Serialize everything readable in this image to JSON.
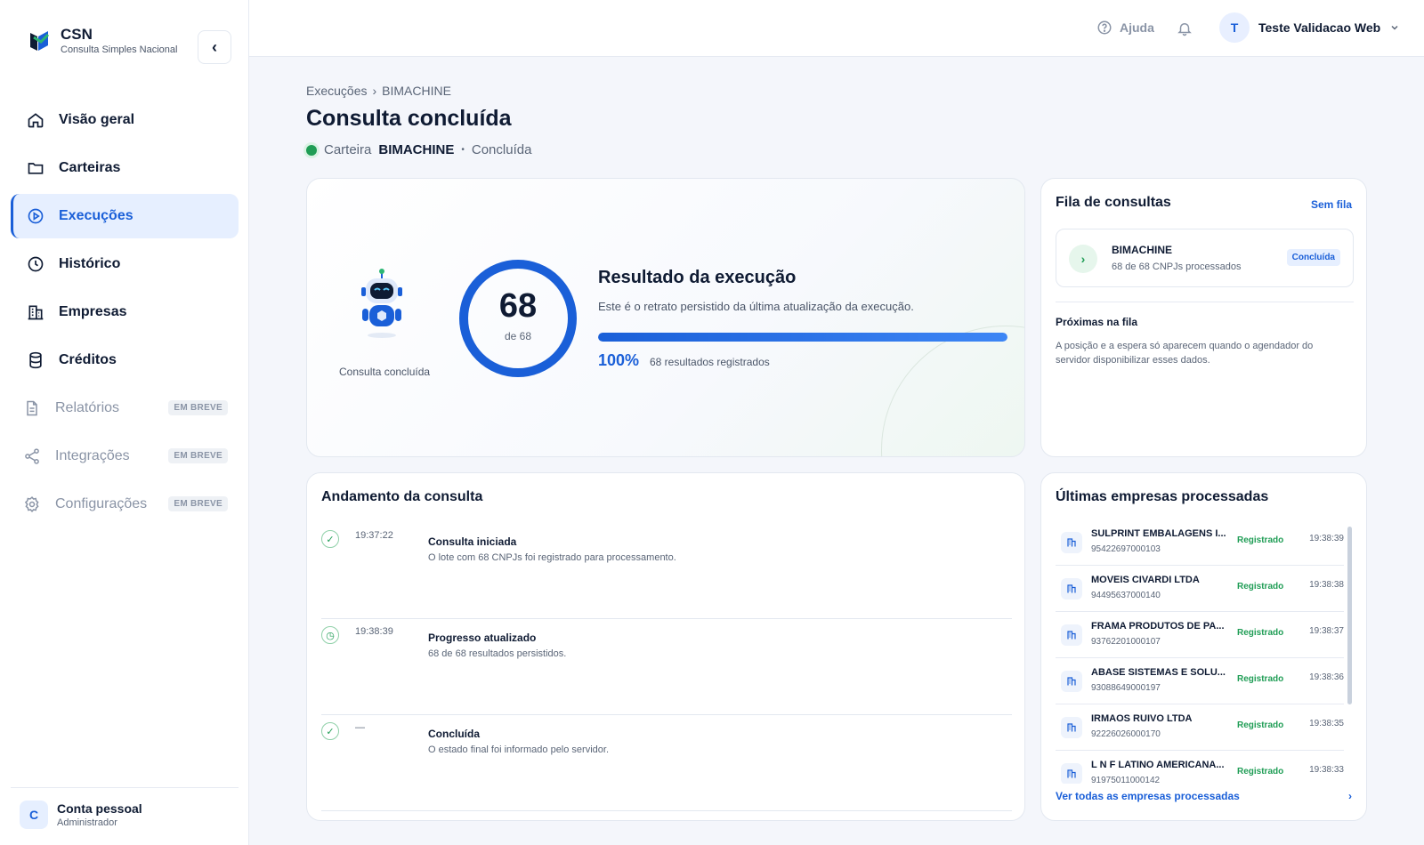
{
  "brand": {
    "title": "CSN",
    "subtitle": "Consulta Simples Nacional"
  },
  "sidebar": {
    "items": [
      {
        "label": "Visão geral",
        "icon": "home-icon"
      },
      {
        "label": "Carteiras",
        "icon": "folder-icon"
      },
      {
        "label": "Execuções",
        "icon": "play-circle-icon",
        "active": true
      },
      {
        "label": "Histórico",
        "icon": "clock-icon"
      },
      {
        "label": "Empresas",
        "icon": "building-icon"
      },
      {
        "label": "Créditos",
        "icon": "database-icon"
      },
      {
        "label": "Relatórios",
        "icon": "document-icon",
        "badge": "EM BREVE"
      },
      {
        "label": "Integrações",
        "icon": "share-icon",
        "badge": "EM BREVE"
      },
      {
        "label": "Configurações",
        "icon": "gear-icon",
        "badge": "EM BREVE"
      }
    ],
    "account": {
      "initial": "C",
      "name": "Conta pessoal",
      "role": "Administrador"
    }
  },
  "topbar": {
    "help_label": "Ajuda",
    "user_initial": "T",
    "user_name": "Teste Validacao Web"
  },
  "breadcrumb": {
    "parent": "Execuções",
    "separator": "›",
    "current": "BIMACHINE"
  },
  "page": {
    "title": "Consulta concluída",
    "wallet_label": "Carteira",
    "wallet_name": "BIMACHINE",
    "separator": "•",
    "status": "Concluída"
  },
  "result": {
    "robot_label": "Consulta concluída",
    "count": "68",
    "of_total": "de 68",
    "title": "Resultado da execução",
    "description": "Este é o retrato persistido da última atualização da execução.",
    "progress": 1.0,
    "percent_label": "100%",
    "records_label": "68 resultados registrados"
  },
  "queue": {
    "title": "Fila de consultas",
    "link": "Sem fila",
    "item": {
      "name": "BIMACHINE",
      "sub": "68 de 68 CNPJs processados",
      "badge": "Concluída"
    },
    "next_title": "Próximas na fila",
    "next_desc": "A posição e a espera só aparecem quando o agendador do servidor disponibilizar esses dados."
  },
  "progress": {
    "title": "Andamento da consulta",
    "events": [
      {
        "time": "19:37:22",
        "title": "Consulta iniciada",
        "desc": "O lote com 68 CNPJs foi registrado para processamento.",
        "icon": "check-icon"
      },
      {
        "time": "19:38:39",
        "title": "Progresso atualizado",
        "desc": "68 de 68 resultados persistidos.",
        "icon": "clock-icon"
      },
      {
        "time": "—",
        "title": "Concluída",
        "desc": "O estado final foi informado pelo servidor.",
        "icon": "check-icon"
      }
    ]
  },
  "latest": {
    "title": "Últimas empresas processadas",
    "companies": [
      {
        "name": "SULPRINT EMBALAGENS I...",
        "cnpj": "95422697000103",
        "status": "Registrado",
        "time": "19:38:39"
      },
      {
        "name": "MOVEIS CIVARDI LTDA",
        "cnpj": "94495637000140",
        "status": "Registrado",
        "time": "19:38:38"
      },
      {
        "name": "FRAMA PRODUTOS DE PA...",
        "cnpj": "93762201000107",
        "status": "Registrado",
        "time": "19:38:37"
      },
      {
        "name": "ABASE SISTEMAS E SOLU...",
        "cnpj": "93088649000197",
        "status": "Registrado",
        "time": "19:38:36"
      },
      {
        "name": "IRMAOS RUIVO LTDA",
        "cnpj": "92226026000170",
        "status": "Registrado",
        "time": "19:38:35"
      },
      {
        "name": "L N F LATINO AMERICANA...",
        "cnpj": "91975011000142",
        "status": "Registrado",
        "time": "19:38:33"
      }
    ],
    "see_all": "Ver todas as empresas processadas",
    "see_all_arrow": "›"
  },
  "colors": {
    "accent": "#1a5fd8",
    "success": "#1f9d55",
    "background": "#f4f6fb"
  }
}
